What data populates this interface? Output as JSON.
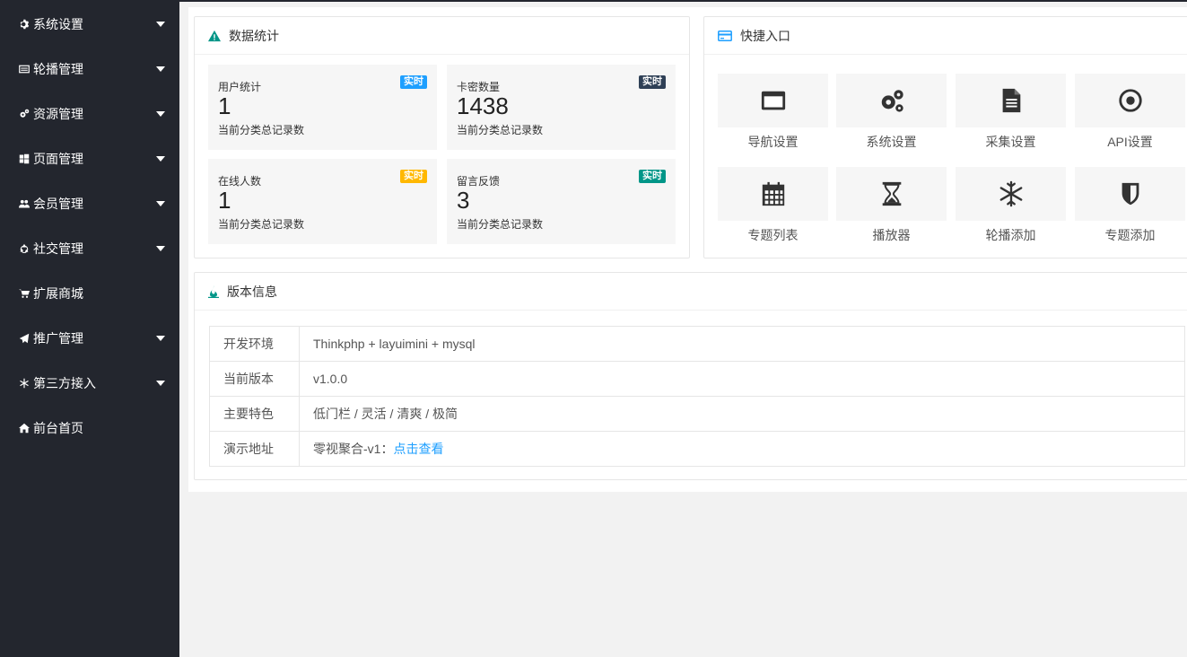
{
  "sidebar": {
    "items": [
      {
        "label": "系统设置",
        "icon": "gear-icon",
        "has_arrow": true
      },
      {
        "label": "轮播管理",
        "icon": "slides-icon",
        "has_arrow": true
      },
      {
        "label": "资源管理",
        "icon": "gears-icon",
        "has_arrow": true
      },
      {
        "label": "页面管理",
        "icon": "windows-icon",
        "has_arrow": true
      },
      {
        "label": "会员管理",
        "icon": "users-icon",
        "has_arrow": true
      },
      {
        "label": "社交管理",
        "icon": "recycle-icon",
        "has_arrow": true
      },
      {
        "label": "扩展商城",
        "icon": "cart-icon",
        "has_arrow": false
      },
      {
        "label": "推广管理",
        "icon": "paper-plane-icon",
        "has_arrow": true
      },
      {
        "label": "第三方接入",
        "icon": "snowflake-icon",
        "has_arrow": true
      },
      {
        "label": "前台首页",
        "icon": "home-icon",
        "has_arrow": false
      }
    ]
  },
  "stats": {
    "title": "数据统计",
    "cards": [
      {
        "label": "用户统计",
        "value": "1",
        "sub": "当前分类总记录数",
        "badge": "实时",
        "badge_color": "#1E9FFF"
      },
      {
        "label": "卡密数量",
        "value": "1438",
        "sub": "当前分类总记录数",
        "badge": "实时",
        "badge_color": "#2F4056"
      },
      {
        "label": "在线人数",
        "value": "1",
        "sub": "当前分类总记录数",
        "badge": "实时",
        "badge_color": "#FFB800"
      },
      {
        "label": "留言反馈",
        "value": "3",
        "sub": "当前分类总记录数",
        "badge": "实时",
        "badge_color": "#009688"
      }
    ]
  },
  "quick": {
    "title": "快捷入口",
    "items": [
      {
        "label": "导航设置",
        "icon": "window-icon"
      },
      {
        "label": "系统设置",
        "icon": "gears-icon"
      },
      {
        "label": "采集设置",
        "icon": "file-text-icon"
      },
      {
        "label": "API设置",
        "icon": "dot-circle-icon"
      },
      {
        "label": "专题列表",
        "icon": "calendar-icon"
      },
      {
        "label": "播放器",
        "icon": "hourglass-icon"
      },
      {
        "label": "轮播添加",
        "icon": "snowflake-icon"
      },
      {
        "label": "专题添加",
        "icon": "shield-icon"
      }
    ]
  },
  "version": {
    "title": "版本信息",
    "rows": [
      {
        "key": "开发环境",
        "value": "Thinkphp + layuimini + mysql"
      },
      {
        "key": "当前版本",
        "value": "v1.0.0"
      },
      {
        "key": "主要特色",
        "value": "低门栏 / 灵活 / 清爽 / 极简"
      },
      {
        "key": "演示地址",
        "value": "零视聚合-v1：",
        "link": "点击查看"
      }
    ]
  },
  "colors": {
    "sidebar_bg": "#23262e",
    "link": "#1E9FFF",
    "header_icon_green": "#009688",
    "header_icon_blue": "#1E9FFF"
  }
}
